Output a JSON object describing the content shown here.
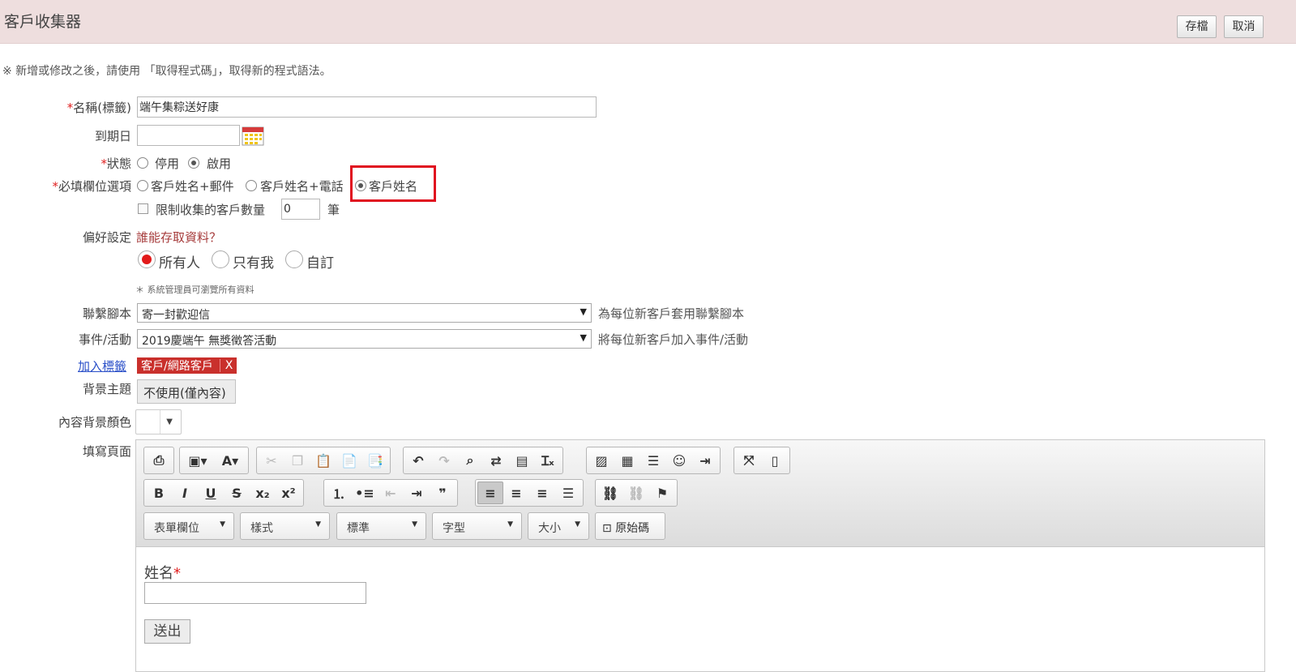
{
  "header": {
    "title": "客戶收集器",
    "save_label": "存檔",
    "cancel_label": "取消"
  },
  "notice": "※ 新增或修改之後，請使用 「取得程式碼」，取得新的程式語法。",
  "form": {
    "name": {
      "required_mark": "*",
      "label": "名稱(標籤)",
      "value": "端午集粽送好康"
    },
    "expiry": {
      "label": "到期日",
      "value": ""
    },
    "status": {
      "required_mark": "*",
      "label": "狀態",
      "options": [
        "停用",
        "啟用"
      ],
      "selected": "啟用"
    },
    "required_fields": {
      "required_mark": "*",
      "label": "必填欄位選項",
      "options": [
        "客戶姓名+郵件",
        "客戶姓名+電話",
        "客戶姓名"
      ],
      "selected": "客戶姓名"
    },
    "limit": {
      "label": "限制收集的客戶數量",
      "value": "0",
      "unit": "筆",
      "checked": false
    },
    "preference": {
      "label": "偏好設定",
      "link": "誰能存取資料？",
      "options": [
        "所有人",
        "只有我",
        "自訂"
      ],
      "selected": "所有人",
      "note": "＊ 系統管理員可瀏覽所有資料"
    },
    "script": {
      "label": "聯繫腳本",
      "value": "寄一封歡迎信",
      "note": "為每位新客戶套用聯繫腳本"
    },
    "event": {
      "label": "事件/活動",
      "value": "2019慶端午 無獎徵答活動",
      "note": "將每位新客戶加入事件/活動"
    },
    "tags": {
      "add_label": "加入標籤",
      "items": [
        "客戶/網路客戶"
      ],
      "remove_label": "X"
    },
    "theme": {
      "label": "背景主題",
      "value": "不使用(僅內容)"
    },
    "bg_color": {
      "label": "內容背景顏色",
      "arrow": "▼"
    },
    "page": {
      "label": "填寫頁面"
    }
  },
  "editor": {
    "combos": [
      "表單欄位",
      "樣式",
      "標準",
      "字型",
      "大小"
    ],
    "source_label": "原始碼",
    "content": {
      "field_label": "姓名",
      "required_mark": "*",
      "submit_label": "送出"
    }
  },
  "colors": {
    "header_bg": "#eedede",
    "required": "#e02020",
    "highlight": "#e00f1f",
    "tag_bg": "#c9302c",
    "link_blue": "#2a4fc8",
    "link_red": "#a63b3b"
  }
}
